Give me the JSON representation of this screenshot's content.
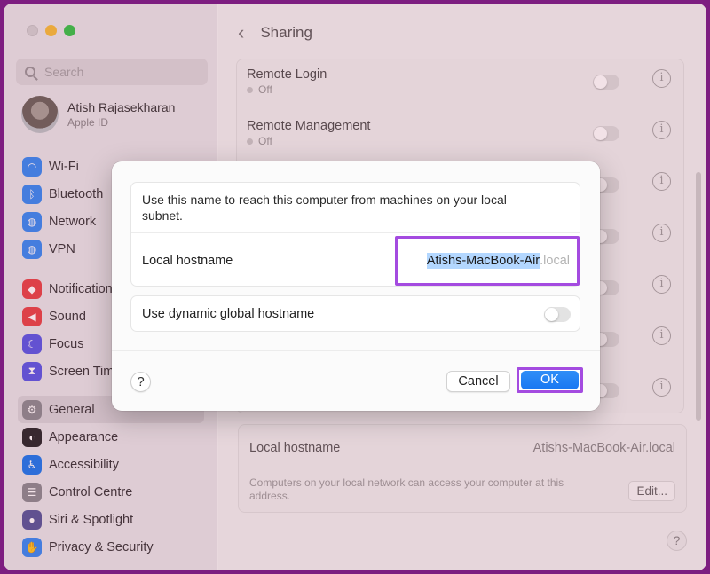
{
  "sidebar": {
    "search_placeholder": "Search",
    "profile": {
      "name": "Atish Rajasekharan",
      "subtitle": "Apple ID"
    },
    "items": [
      {
        "label": "Wi-Fi",
        "icon": "wifi-icon",
        "color": "#3b8cf5"
      },
      {
        "label": "Bluetooth",
        "icon": "bluetooth-icon",
        "color": "#3b8cf5"
      },
      {
        "label": "Network",
        "icon": "globe-icon",
        "color": "#3b8cf5"
      },
      {
        "label": "VPN",
        "icon": "vpn-globe-icon",
        "color": "#3b8cf5"
      },
      {
        "label": "Notifications",
        "icon": "bell-icon",
        "color": "#e8484c"
      },
      {
        "label": "Sound",
        "icon": "speaker-icon",
        "color": "#e8484c"
      },
      {
        "label": "Focus",
        "icon": "moon-icon",
        "color": "#5d5ce6"
      },
      {
        "label": "Screen Time",
        "icon": "hourglass-icon",
        "color": "#5d5ce6"
      },
      {
        "label": "General",
        "icon": "gear-icon",
        "color": "#8e8e93",
        "selected": true
      },
      {
        "label": "Appearance",
        "icon": "appearance-icon",
        "color": "#2c2c2e"
      },
      {
        "label": "Accessibility",
        "icon": "accessibility-icon",
        "color": "#1f7cf0"
      },
      {
        "label": "Control Centre",
        "icon": "toggles-icon",
        "color": "#8e8e93"
      },
      {
        "label": "Siri & Spotlight",
        "icon": "siri-icon",
        "color": "#5b5b9c"
      },
      {
        "label": "Privacy & Security",
        "icon": "hand-icon",
        "color": "#3b8cf5"
      }
    ]
  },
  "main": {
    "title": "Sharing",
    "services": [
      {
        "name": "Remote Login",
        "status": "Off"
      },
      {
        "name": "Remote Management",
        "status": "Off"
      }
    ],
    "hostname_label": "Local hostname",
    "hostname_value": "Atishs-MacBook-Air.local",
    "hostname_note": "Computers on your local network can access your computer at this address.",
    "edit_label": "Edit...",
    "help_label": "?"
  },
  "dialog": {
    "description": "Use this name to reach this computer from machines on your local subnet.",
    "hostname_label": "Local hostname",
    "hostname_selected": "Atishs-MacBook-Air",
    "hostname_suffix": ".local",
    "dynamic_label": "Use dynamic global hostname",
    "dynamic_enabled": false,
    "help_label": "?",
    "cancel_label": "Cancel",
    "ok_label": "OK"
  },
  "colors": {
    "highlight": "#a44be0",
    "accent": "#1877f2",
    "selection": "#b3d7ff"
  }
}
